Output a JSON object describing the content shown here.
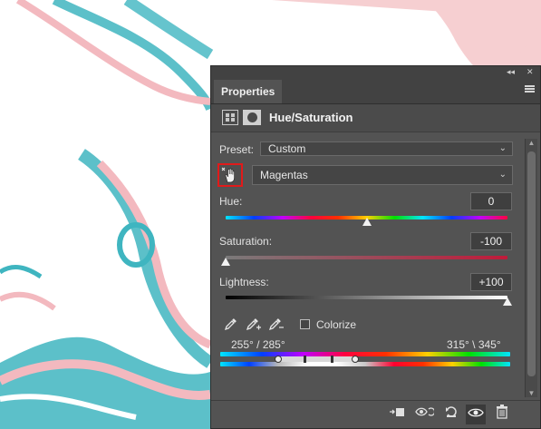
{
  "panel": {
    "collapse_glyph": "◂◂",
    "close_glyph": "✕",
    "tab_label": "Properties",
    "adjustment_title": "Hue/Saturation",
    "preset_label": "Preset:",
    "preset_value": "Custom",
    "channel_value": "Magentas",
    "hue": {
      "label": "Hue:",
      "value": "0",
      "level": 0.5
    },
    "saturation": {
      "label": "Saturation:",
      "value": "-100",
      "level": 0.0
    },
    "lightness": {
      "label": "Lightness:",
      "value": "+100",
      "level": 1.0
    },
    "colorize_label": "Colorize",
    "colorize_checked": false,
    "range_left": "255° / 285°",
    "range_right": "315° \\ 345°",
    "colors": {
      "highlight_border": "#e11a1a",
      "panel_bg": "#535353"
    }
  },
  "icons": {
    "menu": "menu-icon",
    "hand": "hand-target-icon",
    "eyedroppers": [
      "eyedropper-icon",
      "eyedropper-plus-icon",
      "eyedropper-minus-icon"
    ],
    "footer": [
      "clip-to-layer-icon",
      "view-previous-icon",
      "reset-icon",
      "visibility-eye-icon",
      "trash-icon"
    ]
  }
}
